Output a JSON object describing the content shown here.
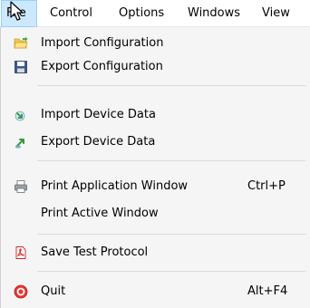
{
  "menubar": {
    "items": [
      {
        "label": "File"
      },
      {
        "label": "Control"
      },
      {
        "label": "Options"
      },
      {
        "label": "Windows"
      },
      {
        "label": "View"
      }
    ]
  },
  "menu": {
    "items": [
      {
        "label": "Import Configuration",
        "icon": "folder-open-icon",
        "shortcut": ""
      },
      {
        "label": "Export Configuration",
        "icon": "save-disk-icon",
        "shortcut": ""
      },
      {
        "label": "Import Device Data",
        "icon": "import-arrow-icon",
        "shortcut": ""
      },
      {
        "label": "Export Device Data",
        "icon": "export-arrow-icon",
        "shortcut": ""
      },
      {
        "label": "Print Application Window",
        "icon": "printer-icon",
        "shortcut": "Ctrl+P"
      },
      {
        "label": "Print Active Window",
        "icon": "",
        "shortcut": ""
      },
      {
        "label": "Save Test Protocol",
        "icon": "pdf-icon",
        "shortcut": ""
      },
      {
        "label": "Quit",
        "icon": "quit-icon",
        "shortcut": "Alt+F4"
      }
    ]
  },
  "colors": {
    "menu_background": "#f5f5f5",
    "active_highlight": "#cce8ff",
    "active_border": "#99d1ff",
    "separator": "#dadada"
  }
}
